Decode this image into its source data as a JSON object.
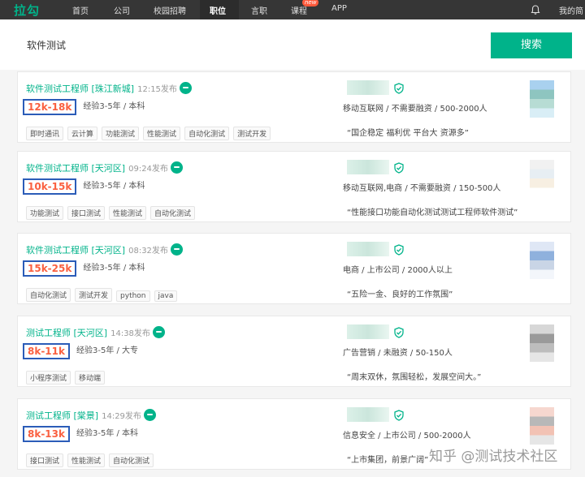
{
  "nav": {
    "logo": "拉勾",
    "items": [
      "首页",
      "公司",
      "校园招聘",
      "职位",
      "言职",
      "课程",
      "APP"
    ],
    "new_badge": "new",
    "user": "我的简"
  },
  "search": {
    "value": "软件测试",
    "button": "搜索"
  },
  "jobs": [
    {
      "title": "软件测试工程师 [珠江新城]",
      "time": "12:15发布",
      "salary": "12k-18k",
      "req": "经验3-5年 / 本科",
      "tags": [
        "即时通讯",
        "云计算",
        "功能测试",
        "性能测试",
        "自动化测试",
        "测试开发"
      ],
      "industry": "移动互联网 / 不需要融资 / 500-2000人",
      "advantage": "“国企稳定 福利优 平台大 资源多”"
    },
    {
      "title": "软件测试工程师 [天河区]",
      "time": "09:24发布",
      "salary": "10k-15k",
      "req": "经验3-5年 / 本科",
      "tags": [
        "功能测试",
        "接口测试",
        "性能测试",
        "自动化测试"
      ],
      "industry": "移动互联网,电商 / 不需要融资 / 150-500人",
      "advantage": "“性能接口功能自动化测试测试工程师软件测试”"
    },
    {
      "title": "软件测试工程师 [天河区]",
      "time": "08:32发布",
      "salary": "15k-25k",
      "req": "经验3-5年 / 本科",
      "tags": [
        "自动化测试",
        "测试开发",
        "python",
        "java"
      ],
      "industry": "电商 / 上市公司 / 2000人以上",
      "advantage": "“五险一金、良好的工作氛围”"
    },
    {
      "title": "测试工程师 [天河区]",
      "time": "14:38发布",
      "salary": "8k-11k",
      "req": "经验3-5年 / 大专",
      "tags": [
        "小程序测试",
        "移动端"
      ],
      "industry": "广告营销 / 未融资 / 50-150人",
      "advantage": "“周末双休，氛围轻松，发展空间大。”"
    },
    {
      "title": "测试工程师 [棠景]",
      "time": "14:29发布",
      "salary": "8k-13k",
      "req": "经验3-5年 / 本科",
      "tags": [
        "接口测试",
        "性能测试",
        "自动化测试"
      ],
      "industry": "信息安全 / 上市公司 / 500-2000人",
      "advantage": "“上市集团，前景广阔”"
    }
  ],
  "watermark": "知乎 @测试技术社区",
  "colors": {
    "brand_green": "#00b38a",
    "salary_orange": "#fa6040",
    "highlight_box": "#2b5cb8",
    "topbar": "#363636"
  }
}
